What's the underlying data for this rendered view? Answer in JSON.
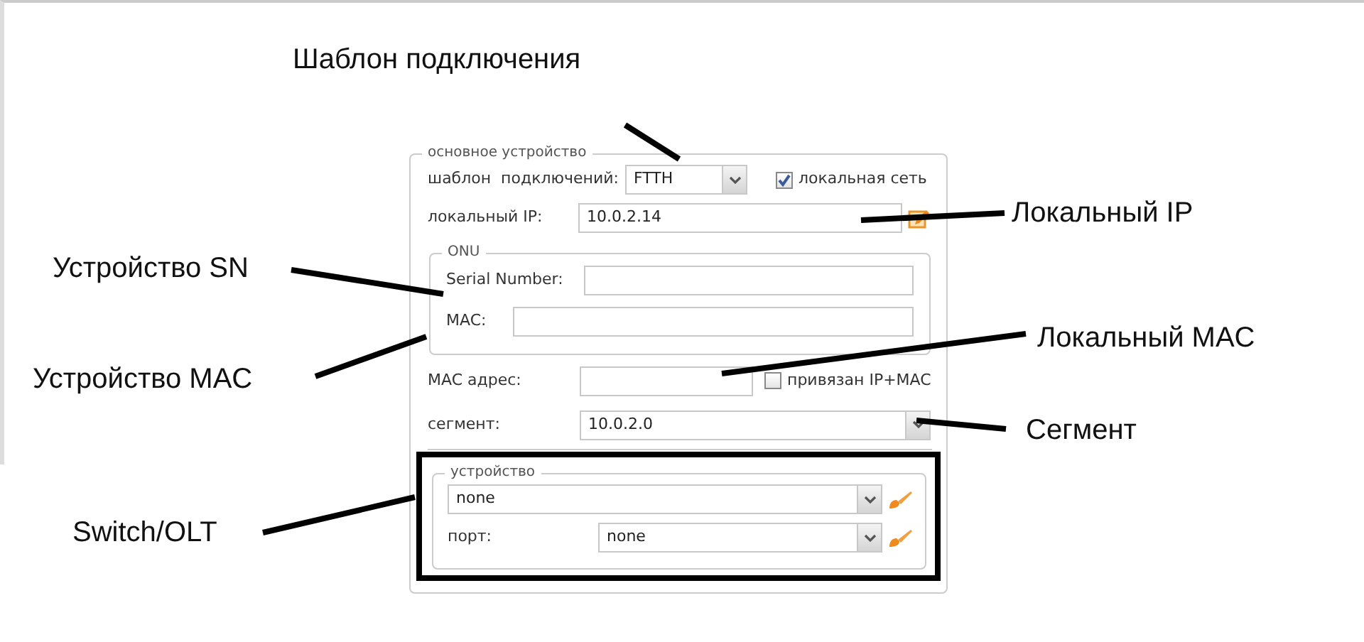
{
  "annotations": [
    {
      "text": "Шаблон подключения"
    },
    {
      "text": "Локальный IP"
    },
    {
      "text": "Устройство SN"
    },
    {
      "text": "Устройство MAC"
    },
    {
      "text": "Локальный MAC"
    },
    {
      "text": "Сегмент"
    },
    {
      "text": "Switch/OLT"
    }
  ],
  "main_device": {
    "legend": "основное устройство",
    "template_label": "шаблон  подключений:",
    "template_value": "FTTH",
    "local_network": {
      "label": "локальная сеть",
      "checked": true
    },
    "local_ip_label": "локальный IP:",
    "local_ip_value": "10.0.2.14",
    "onu": {
      "legend": "ONU",
      "serial_label": "Serial Number:",
      "mac_label": "MAC:"
    },
    "mac_address_label": "MAC адрес:",
    "bind": {
      "label": "привязан IP+MAC",
      "checked": false
    },
    "segment_label": "сегмент:",
    "segment_value": "10.0.2.0"
  },
  "device": {
    "legend": "устройство",
    "device_value": "none",
    "port_label": "порт:",
    "port_value": "none"
  }
}
